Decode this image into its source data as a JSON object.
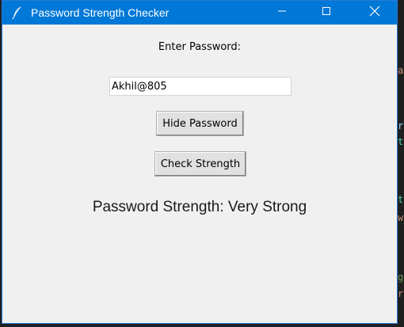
{
  "window": {
    "title": "Password Strength Checker",
    "icon": "feather-icon",
    "controls": [
      "minimize-icon",
      "maximize-icon",
      "close-icon"
    ],
    "titlebar_color": "#0078d7"
  },
  "form": {
    "prompt_label": "Enter Password:",
    "password_value": "Akhil@805",
    "toggle_button_label": "Hide Password",
    "check_button_label": "Check Strength",
    "result_text": "Password Strength: Very Strong"
  }
}
